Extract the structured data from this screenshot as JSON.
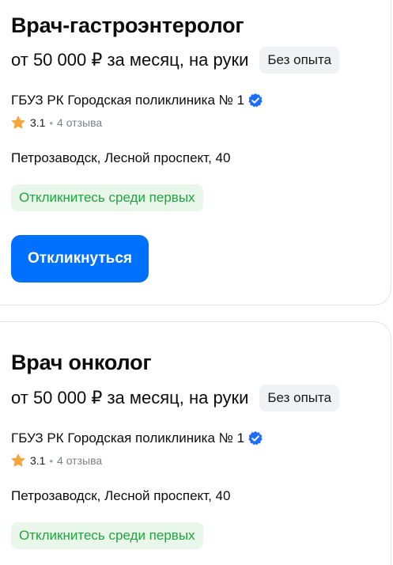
{
  "vacancies": [
    {
      "title": "Врач-гастроэнтеролог",
      "salary": "от 50 000 ₽ за месяц, на руки",
      "experience": "Без опыта",
      "company": "ГБУЗ РК Городская поликлиника № 1",
      "rating": "3.1",
      "reviews": "4 отзыва",
      "address": "Петрозаводск, Лесной проспект, 40",
      "promo": "Откликнитесь среди первых",
      "apply_label": "Откликнуться"
    },
    {
      "title": "Врач онколог",
      "salary": "от 50 000 ₽ за месяц, на руки",
      "experience": "Без опыта",
      "company": "ГБУЗ РК Городская поликлиника № 1",
      "rating": "3.1",
      "reviews": "4 отзыва",
      "address": "Петрозаводск, Лесной проспект, 40",
      "promo": "Откликнитесь среди первых"
    }
  ],
  "icons": {
    "verified": "verified-checkmark-icon",
    "star": "star-icon"
  },
  "colors": {
    "accent": "#0070ff",
    "verified": "#1e6cff",
    "star": "#f7a43a",
    "promo_text": "#1fa53d",
    "promo_bg": "#e8f7ea",
    "badge_bg": "#f1f2f5"
  }
}
